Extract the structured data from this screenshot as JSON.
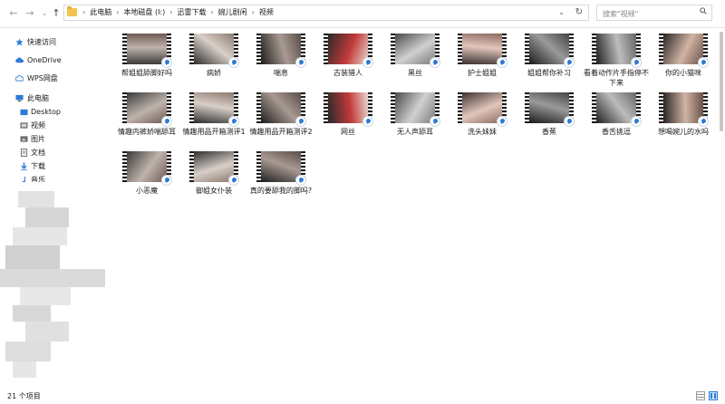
{
  "nav": {
    "back_icon": "arrow-left-icon",
    "forward_icon": "arrow-right-icon",
    "recent_icon": "chevron-down-icon",
    "up_icon": "arrow-up-icon"
  },
  "address": {
    "crumbs": [
      "此电脑",
      "本地磁盘 (I:)",
      "迅雷下载",
      "婉儿剧闲",
      "视频"
    ],
    "separator": "›",
    "dropdown": "⌄",
    "refresh": "↻"
  },
  "search": {
    "placeholder": "搜索\"视频\""
  },
  "sidebar": {
    "items": [
      {
        "label": "快速访问",
        "icon": "star-icon",
        "color": "#2d7ad6"
      },
      {
        "label": "OneDrive",
        "icon": "cloud-icon",
        "color": "#2d7ad6"
      },
      {
        "label": "WPS网盘",
        "icon": "cloud-outline-icon",
        "color": "#2d7ad6"
      },
      {
        "label": "此电脑",
        "icon": "computer-icon",
        "color": "#2d7ad6"
      },
      {
        "label": "Desktop",
        "icon": "desktop-folder-icon",
        "color": "#2d7ad6"
      },
      {
        "label": "视频",
        "icon": "video-folder-icon",
        "color": "#555555"
      },
      {
        "label": "图片",
        "icon": "picture-folder-icon",
        "color": "#555555"
      },
      {
        "label": "文档",
        "icon": "document-folder-icon",
        "color": "#555555"
      },
      {
        "label": "下载",
        "icon": "download-icon",
        "color": "#2d7ad6"
      },
      {
        "label": "音乐",
        "icon": "music-icon",
        "color": "#2d7ad6"
      }
    ]
  },
  "files": [
    {
      "name": "帮姐姐舔脚好吗"
    },
    {
      "name": "病娇"
    },
    {
      "name": "喘息"
    },
    {
      "name": "古装猎人"
    },
    {
      "name": "黑丝"
    },
    {
      "name": "护士姐姐"
    },
    {
      "name": "姐姐帮你补习"
    },
    {
      "name": "看着动作片手指停不下来"
    },
    {
      "name": "你的小猫咪"
    },
    {
      "name": "情趣内裤娇喘舔耳"
    },
    {
      "name": "情趣用品开箱测评1"
    },
    {
      "name": "情趣用品开箱测评2"
    },
    {
      "name": "网丝"
    },
    {
      "name": "无人声舔耳"
    },
    {
      "name": "洗头妹妹"
    },
    {
      "name": "香蕉"
    },
    {
      "name": "香舌挑逗"
    },
    {
      "name": "想喝婉儿的水吗"
    },
    {
      "name": "小恶魔"
    },
    {
      "name": "御姐女仆装"
    },
    {
      "name": "真的要舔我的脚吗?"
    }
  ],
  "file_icon": "video-file-icon",
  "status": {
    "count": "21 个项目"
  },
  "colors": {
    "accent": "#2d7ad6",
    "folder": "#f3c44d"
  }
}
